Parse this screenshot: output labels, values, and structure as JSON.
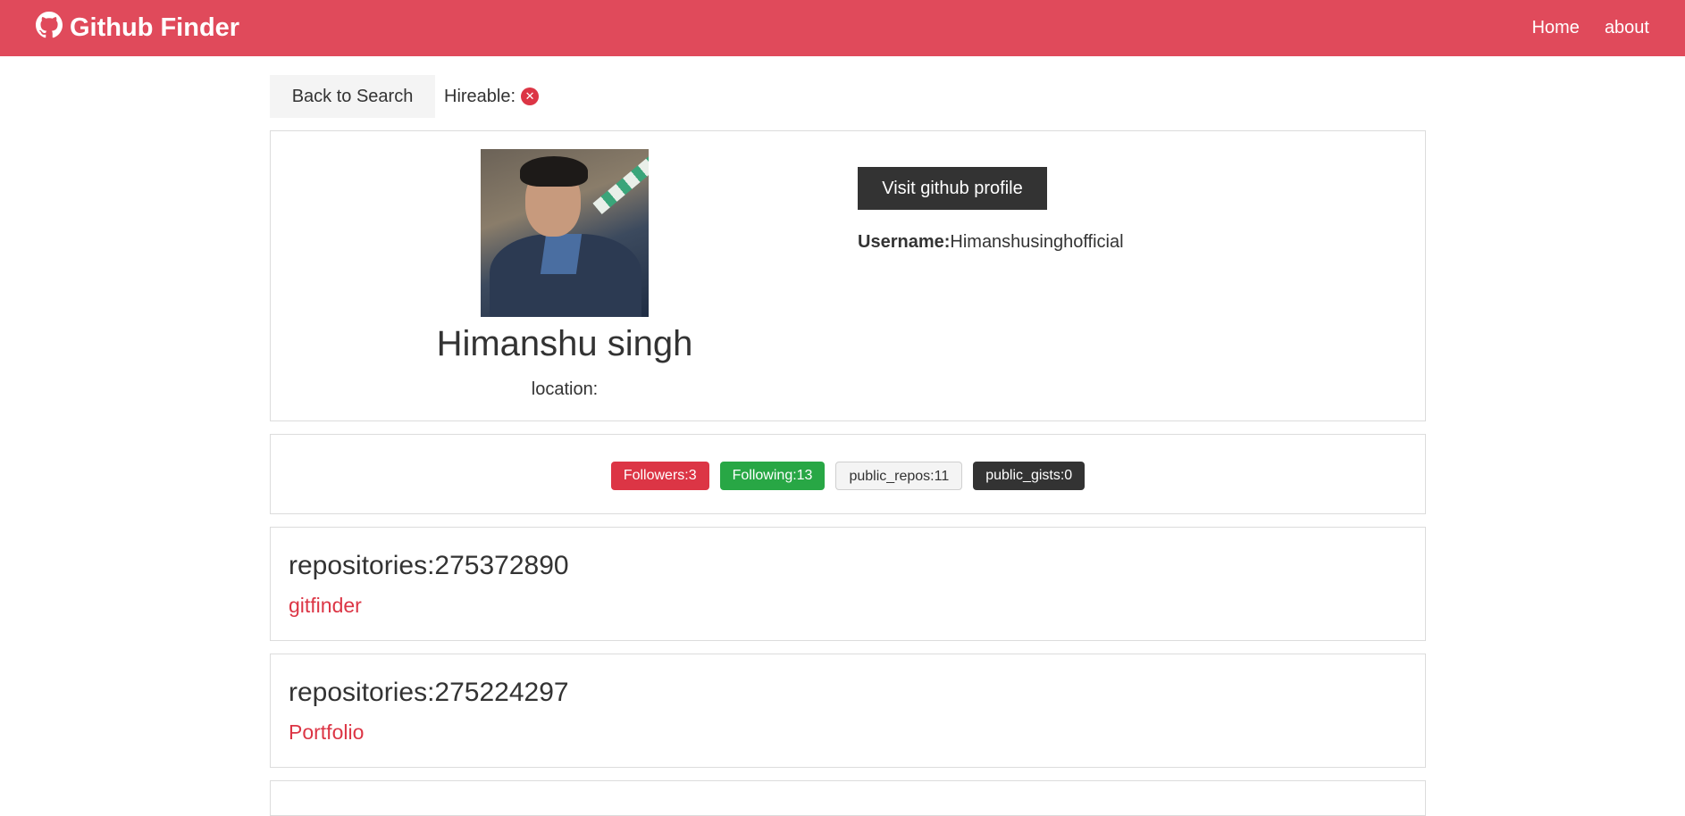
{
  "navbar": {
    "brand": "Github Finder",
    "links": [
      "Home",
      "about"
    ]
  },
  "topbar": {
    "back_label": "Back to Search",
    "hireable_label": "Hireable:",
    "hireable_icon": "times-circle-icon"
  },
  "profile": {
    "name": "Himanshu singh",
    "location_label": "location:",
    "visit_label": "Visit github profile",
    "username_label": "Username:",
    "username": "Himanshusinghofficial"
  },
  "badges": {
    "followers": "Followers:3",
    "following": "Following:13",
    "public_repos": "public_repos:11",
    "public_gists": "public_gists:0"
  },
  "repos": [
    {
      "title": "repositories:275372890",
      "name": "gitfinder"
    },
    {
      "title": "repositories:275224297",
      "name": "Portfolio"
    }
  ],
  "colors": {
    "navbar": "#e04a5b",
    "danger": "#dc3545",
    "success": "#28a745",
    "dark": "#333333",
    "light": "#f4f4f4"
  }
}
